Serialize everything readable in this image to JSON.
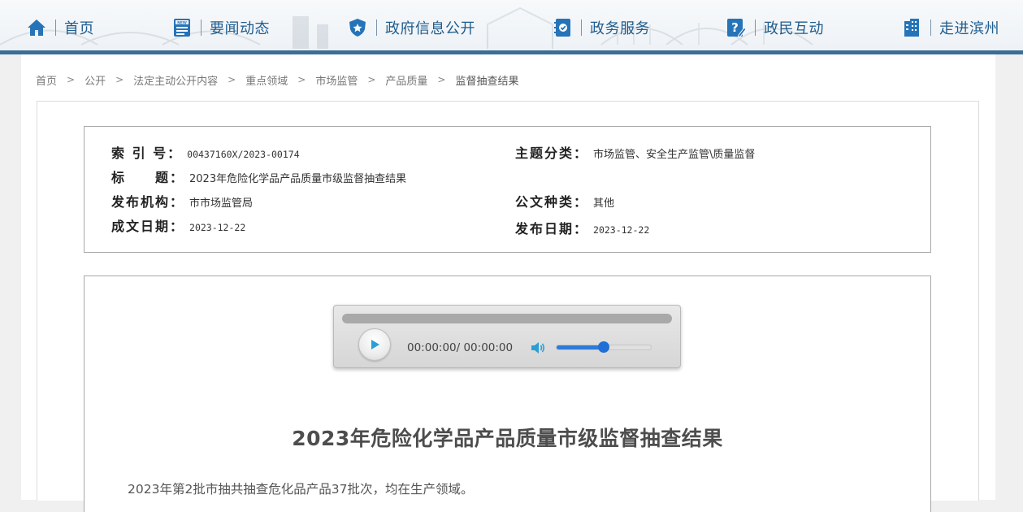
{
  "nav": {
    "items": [
      {
        "label": "首页",
        "icon": "home-icon"
      },
      {
        "label": "要闻动态",
        "icon": "news-icon"
      },
      {
        "label": "政府信息公开",
        "icon": "shield-icon"
      },
      {
        "label": "政务服务",
        "icon": "service-icon"
      },
      {
        "label": "政民互动",
        "icon": "question-icon"
      },
      {
        "label": "走进滨州",
        "icon": "building-icon"
      }
    ]
  },
  "breadcrumb": [
    "首页",
    "公开",
    "法定主动公开内容",
    "重点领域",
    "市场监管",
    "产品质量",
    "监督抽查结果"
  ],
  "breadcrumb_sep": ">",
  "info": {
    "index_no": {
      "key": "索 引 号：",
      "value": "00437160X/2023-00174"
    },
    "subject": {
      "key": "主题分类：",
      "value": "市场监管、安全生产监管\\质量监督"
    },
    "title": {
      "key": "标　　题：",
      "value": "2023年危险化学品产品质量市级监督抽查结果"
    },
    "publisher": {
      "key": "发布机构：",
      "value": "市市场监管局"
    },
    "doc_type": {
      "key": "公文种类：",
      "value": "其他"
    },
    "written_date": {
      "key": "成文日期：",
      "value": "2023-12-22"
    },
    "publish_date": {
      "key": "发布日期：",
      "value": "2023-12-22"
    }
  },
  "player": {
    "time": "00:00:00/ 00:00:00",
    "volume": 0.5,
    "progress": 0
  },
  "article": {
    "title": "2023年危险化学品产品质量市级监督抽查结果",
    "paragraph": "2023年第2批市抽共抽查危化品产品37批次，均在生产领域。"
  },
  "colors": {
    "nav_text": "#1f5d8d",
    "nav_bar": "#3c6e95",
    "volume_fill": "#2b7bdb"
  }
}
